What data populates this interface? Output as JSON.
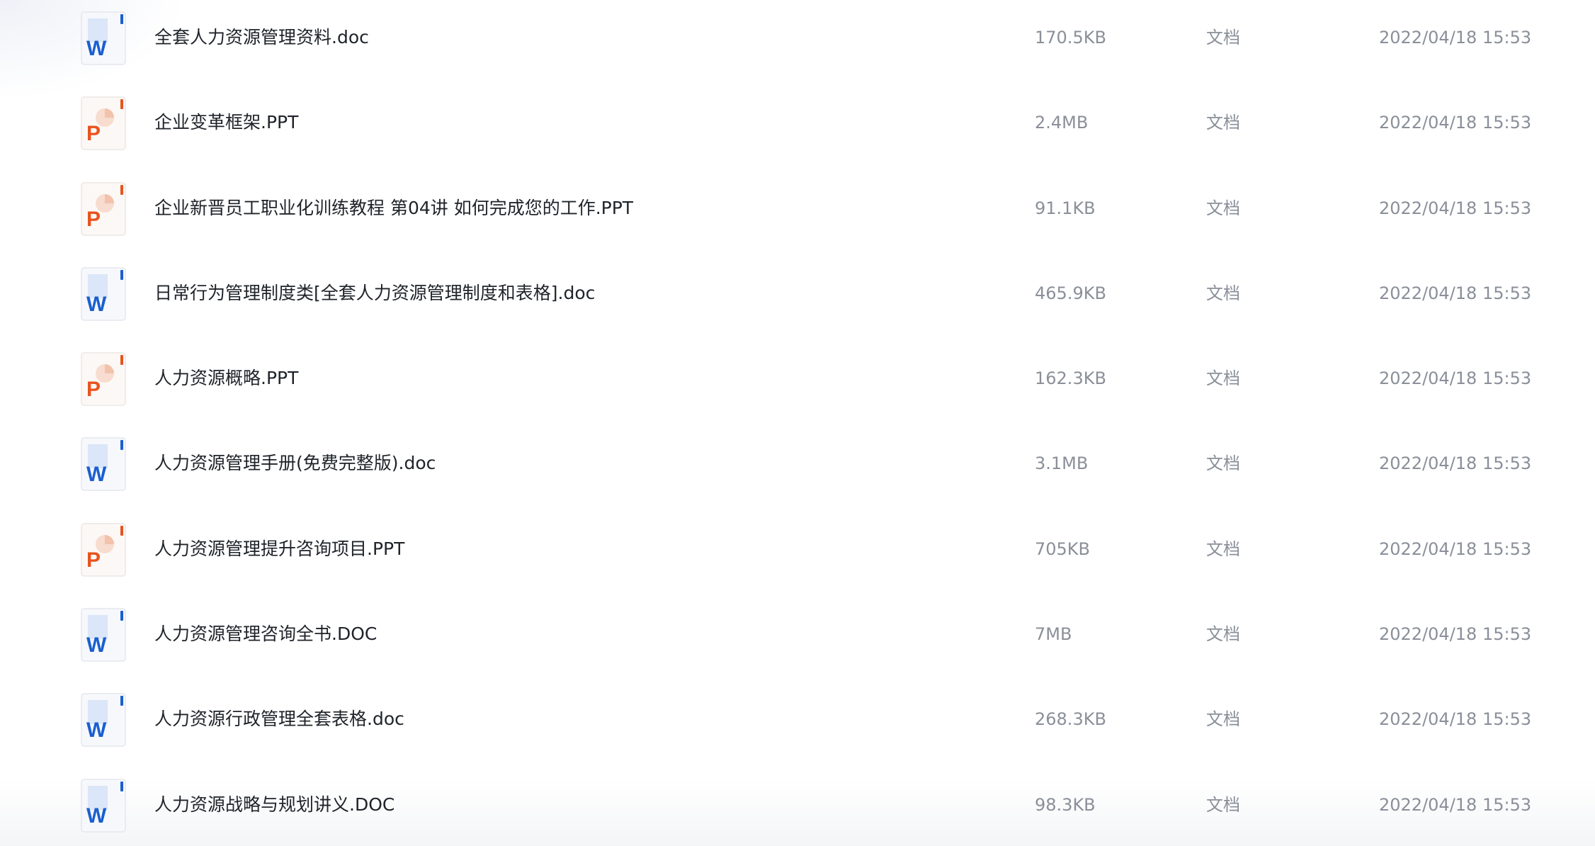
{
  "files": [
    {
      "name": "全套人力资源管理资料.doc",
      "size": "170.5KB",
      "type": "文档",
      "modified": "2022/04/18 15:53",
      "icon": "word-doc-icon"
    },
    {
      "name": "企业变革框架.PPT",
      "size": "2.4MB",
      "type": "文档",
      "modified": "2022/04/18 15:53",
      "icon": "powerpoint-icon"
    },
    {
      "name": "企业新晋员工职业化训练教程 第04讲 如何完成您的工作.PPT",
      "size": "91.1KB",
      "type": "文档",
      "modified": "2022/04/18 15:53",
      "icon": "powerpoint-icon"
    },
    {
      "name": "日常行为管理制度类[全套人力资源管理制度和表格].doc",
      "size": "465.9KB",
      "type": "文档",
      "modified": "2022/04/18 15:53",
      "icon": "word-doc-icon"
    },
    {
      "name": "人力资源概略.PPT",
      "size": "162.3KB",
      "type": "文档",
      "modified": "2022/04/18 15:53",
      "icon": "powerpoint-icon"
    },
    {
      "name": "人力资源管理手册(免费完整版).doc",
      "size": "3.1MB",
      "type": "文档",
      "modified": "2022/04/18 15:53",
      "icon": "word-doc-icon"
    },
    {
      "name": "人力资源管理提升咨询项目.PPT",
      "size": "705KB",
      "type": "文档",
      "modified": "2022/04/18 15:53",
      "icon": "powerpoint-icon"
    },
    {
      "name": "人力资源管理咨询全书.DOC",
      "size": "7MB",
      "type": "文档",
      "modified": "2022/04/18 15:53",
      "icon": "word-doc-icon"
    },
    {
      "name": "人力资源行政管理全套表格.doc",
      "size": "268.3KB",
      "type": "文档",
      "modified": "2022/04/18 15:53",
      "icon": "word-doc-icon"
    },
    {
      "name": "人力资源战略与规划讲义.DOC",
      "size": "98.3KB",
      "type": "文档",
      "modified": "2022/04/18 15:53",
      "icon": "word-doc-icon"
    }
  ],
  "icon_letters": {
    "word": "W",
    "powerpoint": "P"
  },
  "colors": {
    "word_blue": "#1a5fd0",
    "ppt_orange": "#e8541e",
    "text_primary": "#1f2329",
    "text_secondary": "#8a8f99"
  }
}
